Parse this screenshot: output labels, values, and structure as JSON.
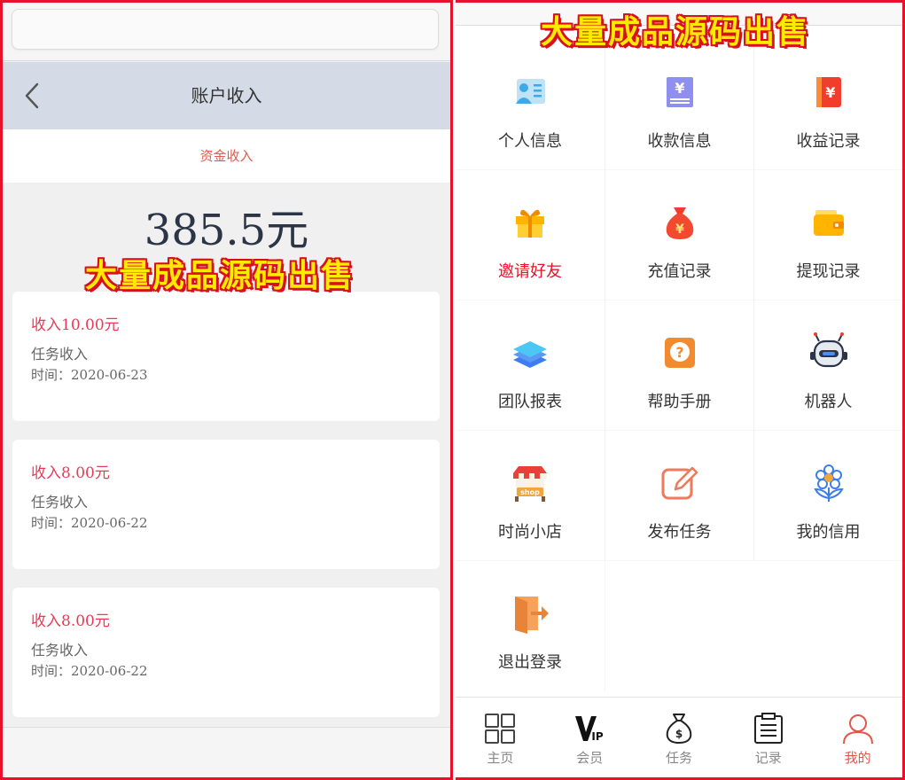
{
  "watermark_text": "大量成品源码出售",
  "left": {
    "header_title": "账户收入",
    "subtab": "资金收入",
    "total_amount": "385.5元",
    "records": [
      {
        "amount": "收入10.00元",
        "type": "任务收入",
        "time": "时间：2020-06-23"
      },
      {
        "amount": "收入8.00元",
        "type": "任务收入",
        "time": "时间：2020-06-22"
      },
      {
        "amount": "收入8.00元",
        "type": "任务收入",
        "time": "时间：2020-06-22"
      }
    ]
  },
  "right": {
    "menu": [
      {
        "label": "个人信息",
        "icon": "id-card-icon"
      },
      {
        "label": "收款信息",
        "icon": "receipt-icon"
      },
      {
        "label": "收益记录",
        "icon": "red-envelope-icon"
      },
      {
        "label": "邀请好友",
        "icon": "gift-icon"
      },
      {
        "label": "充值记录",
        "icon": "money-bag-icon"
      },
      {
        "label": "提现记录",
        "icon": "wallet-icon"
      },
      {
        "label": "团队报表",
        "icon": "layers-icon"
      },
      {
        "label": "帮助手册",
        "icon": "help-icon"
      },
      {
        "label": "机器人",
        "icon": "robot-icon"
      },
      {
        "label": "时尚小店",
        "icon": "shop-icon"
      },
      {
        "label": "发布任务",
        "icon": "edit-icon"
      },
      {
        "label": "我的信用",
        "icon": "flower-icon"
      },
      {
        "label": "退出登录",
        "icon": "exit-icon"
      }
    ],
    "shop_icon_text": "shop",
    "vip_icon_text": "IP",
    "tabs": [
      {
        "label": "主页",
        "icon": "grid-icon",
        "active": false
      },
      {
        "label": "会员",
        "icon": "vip-icon",
        "active": false
      },
      {
        "label": "任务",
        "icon": "money-bag-outline-icon",
        "active": false
      },
      {
        "label": "记录",
        "icon": "clipboard-icon",
        "active": false
      },
      {
        "label": "我的",
        "icon": "user-icon",
        "active": true
      }
    ]
  },
  "colors": {
    "accent_red": "#e8102a",
    "header_blue_gray": "#d4dbe6",
    "income_red": "#e83a55",
    "tab_active": "#e2574c",
    "watermark_yellow": "#ffea00"
  }
}
